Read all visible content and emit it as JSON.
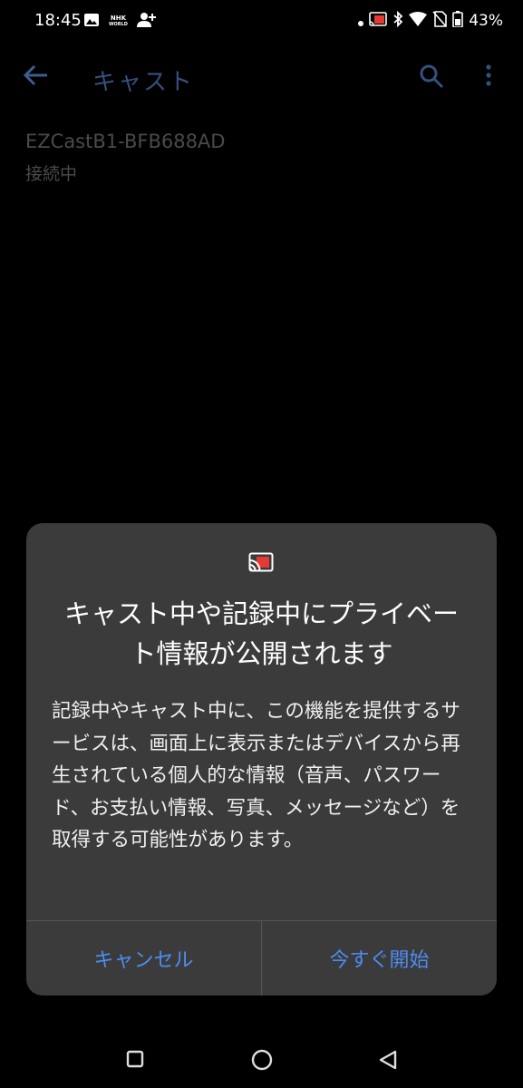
{
  "status_bar": {
    "time": "18:45",
    "nhk_line1": "NHK",
    "nhk_line2": "WORLD",
    "battery": "43%"
  },
  "app_bar": {
    "title": "キャスト"
  },
  "device": {
    "name": "EZCastB1-BFB688AD",
    "status": "接続中"
  },
  "dialog": {
    "title": "キャスト中や記録中にプライベート情報が公開されます",
    "body": "記録中やキャスト中に、この機能を提供するサービスは、画面上に表示またはデバイスから再生されている個人的な情報（音声、パスワード、お支払い情報、写真、メッセージなど）を取得する可能性があります。",
    "cancel_label": "キャンセル",
    "start_label": "今すぐ開始"
  },
  "colors": {
    "accent": "#4c8cf0",
    "dialog_bg": "#3b3b3b",
    "cast_icon_red": "#e53935"
  }
}
